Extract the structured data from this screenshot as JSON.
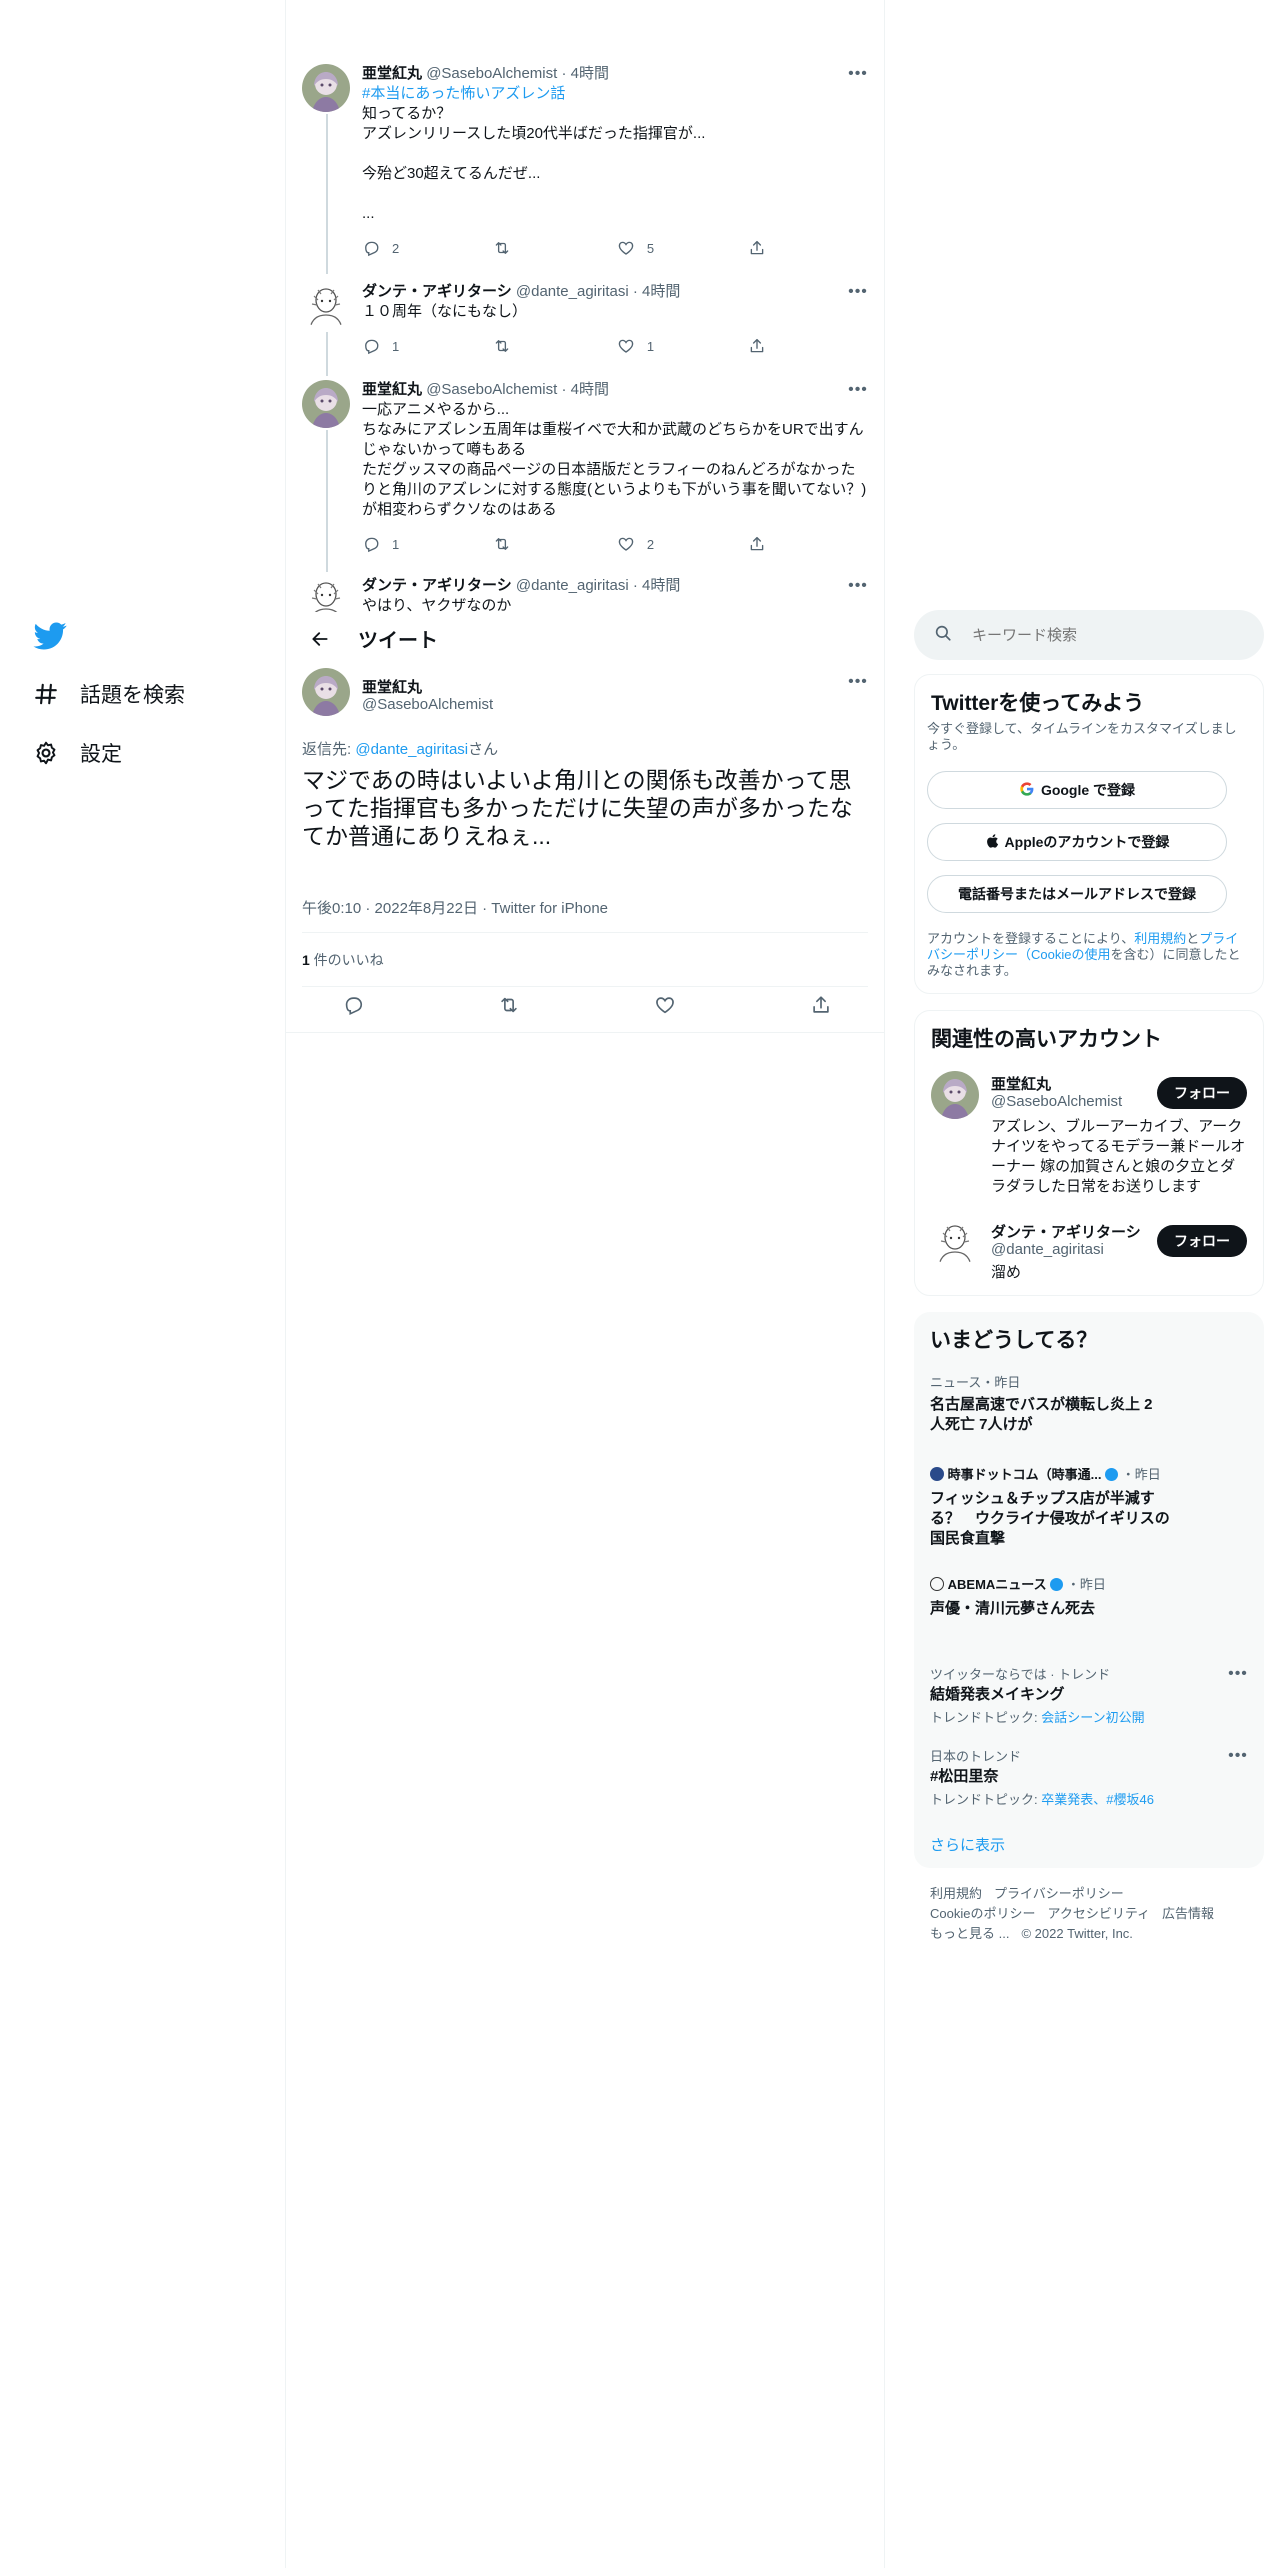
{
  "nav": {
    "items": [
      {
        "label": "話題を検索",
        "icon": "hash-icon"
      },
      {
        "label": "設定",
        "icon": "gear-icon"
      }
    ]
  },
  "thread": [
    {
      "name": "亜堂紅丸",
      "handle": "@SaseboAlchemist",
      "time": "4時間",
      "hashtag": "#本当にあった怖いアズレン話",
      "text": "知ってるか？\nアズレンリリースした頃20代半ばだった指揮官が...\n\n今殆ど30超えてるんだぜ...\n\n...",
      "replies": "2",
      "retweets": "",
      "likes": "5"
    },
    {
      "name": "ダンテ・アギリターシ",
      "handle": "@dante_agiritasi",
      "time": "4時間",
      "text": "１０周年（なにもなし）",
      "replies": "1",
      "retweets": "",
      "likes": "1"
    },
    {
      "name": "亜堂紅丸",
      "handle": "@SaseboAlchemist",
      "time": "4時間",
      "text": "一応アニメやるから...\nちなみにアズレン五周年は重桜イベで大和か武蔵のどちらかをURで出すんじゃないかって噂もある\nただグッスマの商品ページの日本語版だとラフィーのねんどろがなかったりと角川のアズレンに対する態度(というよりも下がいう事を聞いてない？)が相変わらずクソなのはある",
      "replies": "1",
      "retweets": "",
      "likes": "2"
    },
    {
      "name": "ダンテ・アギリターシ",
      "handle": "@dante_agiritasi",
      "time": "4時間",
      "text": "やはり、ヤクザなのか"
    }
  ],
  "header": {
    "title": "ツイート"
  },
  "main_tweet": {
    "name": "亜堂紅丸",
    "handle": "@SaseboAlchemist",
    "reply_prefix": "返信先: ",
    "reply_to": "@dante_agiritasi",
    "reply_suffix": "さん",
    "text": "マジであの時はいよいよ角川との関係も改善かって思ってた指揮官も多かっただけに失望の声が多かったな\nてか普通にありえねぇ...",
    "time": "午後0:10",
    "date": "2022年8月22日",
    "client": "Twitter for iPhone",
    "likes_count": "1",
    "likes_label": " 件のいいね"
  },
  "search": {
    "placeholder": "キーワード検索"
  },
  "signup": {
    "title": "Twitterを使ってみよう",
    "subtitle": "今すぐ登録して、タイムラインをカスタマイズしましょう。",
    "google": "Google で登録",
    "apple": "Appleのアカウントで登録",
    "phone": "電話番号またはメールアドレスで登録",
    "terms_1": "アカウントを登録することにより、",
    "terms_link_1": "利用規約",
    "terms_2": "と",
    "terms_link_2": "プライバシーポリシー（Cookieの使用",
    "terms_3": "を含む）に同意したとみなされます。"
  },
  "related": {
    "title": "関連性の高いアカウント",
    "follow_label": "フォロー",
    "accounts": [
      {
        "name": "亜堂紅丸",
        "handle": "@SaseboAlchemist",
        "bio": "アズレン、ブルーアーカイブ、アークナイツをやってるモデラー兼ドールオーナー 嫁の加賀さんと娘の夕立とダラダラした日常をお送りします"
      },
      {
        "name": "ダンテ・アギリターシ",
        "handle": "@dante_agiritasi",
        "bio": "溜め"
      }
    ]
  },
  "trends": {
    "title": "いまどうしてる？",
    "items": [
      {
        "context": "ニュース・昨日",
        "title": "名古屋高速でバスが横転し炎上 2人死亡 7人けが"
      },
      {
        "source": "時事ドットコム（時事通...",
        "context": "・昨日",
        "title": "フィッシュ＆チップス店が半減する？　ウクライナ侵攻がイギリスの国民食直撃"
      },
      {
        "source": "ABEMAニュース",
        "context": "・昨日",
        "title": "声優・清川元夢さん死去"
      },
      {
        "context": "ツイッターならでは · トレンド",
        "title": "結婚発表メイキング",
        "topic_label": "トレンドトピック: ",
        "topic": "会話シーン初公開"
      },
      {
        "context": "日本のトレンド",
        "title": "#松田里奈",
        "topic_label": "トレンドトピック: ",
        "topic": "卒業発表、#櫻坂46"
      }
    ],
    "show_more": "さらに表示"
  },
  "footer": {
    "links": [
      "利用規約",
      "プライバシーポリシー",
      "Cookieのポリシー",
      "アクセシビリティ",
      "広告情報",
      "もっと見る ..."
    ],
    "copyright": "© 2022 Twitter, Inc."
  },
  "colors": {
    "accent": "#1d9bf0",
    "text": "#0f1419",
    "muted": "#536471",
    "border": "#eff3f4"
  }
}
